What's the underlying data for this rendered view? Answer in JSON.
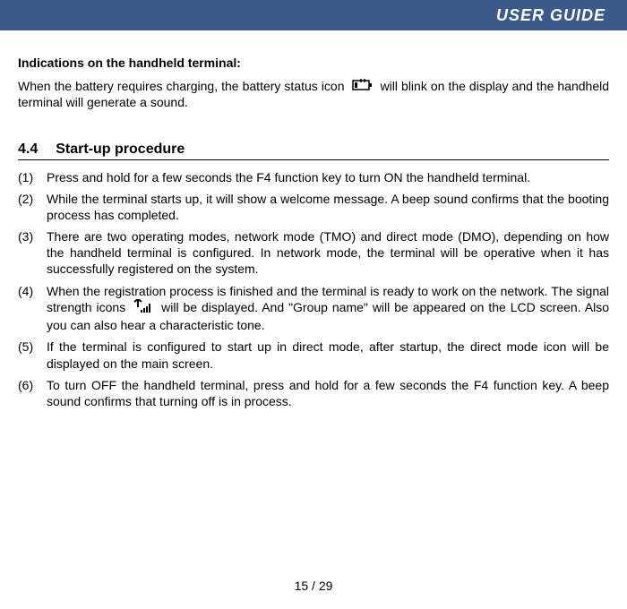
{
  "header": {
    "title": "USER GUIDE"
  },
  "indications": {
    "heading": "Indications on the handheld terminal:",
    "line_before": "When the battery requires charging, the battery status icon ",
    "line_after": " will blink on the display and the handheld terminal will generate a sound."
  },
  "section": {
    "number": "4.4",
    "title": "Start-up procedure"
  },
  "items": {
    "n1": "(1)",
    "t1": "Press and hold for a few seconds the F4 function key to turn ON the handheld terminal.",
    "n2": "(2)",
    "t2": "While the terminal starts up, it will show a welcome message. A beep sound confirms that the booting process has completed.",
    "n3": "(3)",
    "t3": "There are two operating modes, network mode (TMO) and direct mode (DMO), depending on how the handheld terminal is configured. In network mode, the terminal will be operative when it has successfully registered on the system.",
    "n4": "(4)",
    "t4_before": "When the registration process is finished and the terminal is ready to work on the network. The signal strength icons ",
    "t4_after": " will be displayed. And \"Group name\" will be appeared on the LCD screen. Also you can also hear a characteristic tone.",
    "n5": "(5)",
    "t5": "If the terminal is configured to start up in direct mode, after startup, the direct mode icon will be displayed on the main screen.",
    "n6": "(6)",
    "t6": "To turn OFF the handheld terminal, press and hold for a few seconds the F4 function key. A beep sound confirms that turning off is in process."
  },
  "page": {
    "num": "15 / 29"
  }
}
